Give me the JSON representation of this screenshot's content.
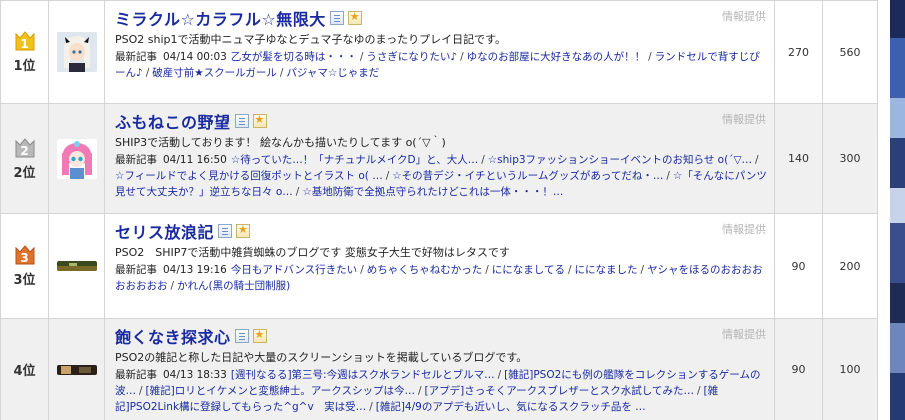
{
  "info_label": "情報提供",
  "latest_label": "最新記事",
  "colors": {
    "title": "#1a2aa0",
    "gold": "#f0b400",
    "silver": "#9a9a9a",
    "bronze": "#c8571a"
  },
  "rows": [
    {
      "rank_num": "1",
      "rank_text": "1位",
      "medal": "gold",
      "thumb": "anime-girl-white-hair",
      "title": "ミラクル☆カラフル☆無限大",
      "desc": "PSO2 ship1で活動中ニュマ子ゆなとデュマ子なゆのまったりプレイ日記です。",
      "date": "04/14 00:03",
      "articles": [
        "乙女が髪を切る時は・・・",
        "うさぎになりたい♪",
        "ゆなのお部屋に大好きなあの人が！！",
        "ランドセルで背すじぴーん♪",
        "破産寸前★スクールガール",
        "パジャマ☆じゃまだ"
      ],
      "in": "270",
      "out": "560"
    },
    {
      "rank_num": "2",
      "rank_text": "2位",
      "medal": "silver",
      "thumb": "anime-girl-pink-hair",
      "title": "ふもねこの野望",
      "desc": "SHIP3で活動しております！ 絵なんかも描いたりしてます o(´▽｀)",
      "date": "04/11 16:50",
      "articles": [
        "☆待っていた…！「ナチュナルメイクD」と、大人…",
        "☆ship3ファッションショーイベントのお知らせ o(´▽…",
        "☆フィールドでよく見かける回復ポットとイラスト o( …",
        "☆その昔デジ・イチというルームグッズがあってだね・…",
        "☆「そんなにパンツ見せて大丈夫か？」逆立ちな日々 o…",
        "☆基地防衛で全拠点守られたけどこれは一体・・・！…"
      ],
      "in": "140",
      "out": "300"
    },
    {
      "rank_num": "3",
      "rank_text": "3位",
      "medal": "bronze",
      "thumb": "landscape-banner",
      "title": "セリス放浪記",
      "desc": "PSO2　SHIP7で活動中雑貨蜘蛛のブログです 変態女子大生で好物はレタスです",
      "date": "04/13 19:16",
      "articles": [
        "今日もアドバンス行きたい",
        "めちゃくちゃねむかった",
        "にになましてる",
        "にになました",
        "ヤシャをほるのおおおおおおおおお",
        "かれん(黒の騎士団制服)"
      ],
      "in": "90",
      "out": "200"
    },
    {
      "rank_num": "",
      "rank_text": "4位",
      "medal": "none",
      "thumb": "game-screenshot-banner",
      "title": "飽くなき探求心",
      "desc": "PSO2の雑記と称した日記や大量のスクリーンショットを掲載しているブログです。",
      "date": "04/13 18:33",
      "articles": [
        "[週刊なるる]第三号:今週はスク水ランドセルとブルマ…",
        "[雑記]PSO2にも例の艦隊をコレクションするゲームの波…",
        "[雑記]ロリとイケメンと変態紳士。アークスシップは今…",
        "[アプデ]さっそくアークスブレザーとスク水試してみた…",
        "[雑記]PSO2Link構に登録してもらった^g^v　実は受…",
        "[雑記]4/9のアプデも近いし、気になるスクラッチ品を …"
      ],
      "in": "90",
      "out": "100"
    }
  ]
}
